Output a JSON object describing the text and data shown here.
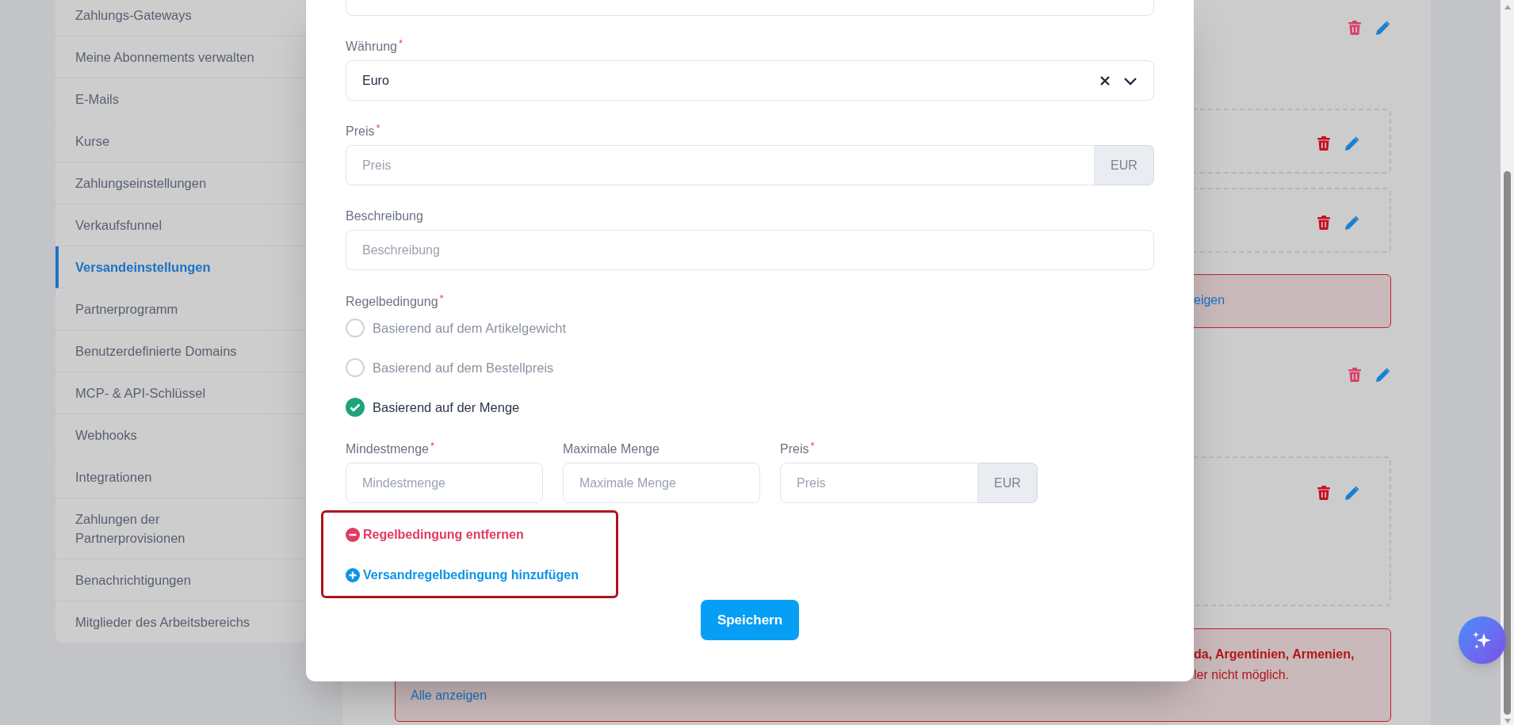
{
  "sidebar": {
    "items": [
      {
        "label": "Zahlungs-Gateways",
        "selected": false
      },
      {
        "label": "Meine Abonnements verwalten",
        "selected": false
      },
      {
        "label": "E-Mails",
        "selected": false
      },
      {
        "label": "Kurse",
        "selected": false
      },
      {
        "label": "Zahlungseinstellungen",
        "selected": false
      },
      {
        "label": "Verkaufsfunnel",
        "selected": false
      },
      {
        "label": "Versandeinstellungen",
        "selected": true
      },
      {
        "label": "Partnerprogramm",
        "selected": false
      },
      {
        "label": "Benutzerdefinierte Domains",
        "selected": false
      },
      {
        "label": "MCP- & API-Schlüssel",
        "selected": false
      },
      {
        "label": "Webhooks",
        "selected": false
      },
      {
        "label": "Integrationen",
        "selected": false
      },
      {
        "label": "Zahlungen der Partnerprovisionen",
        "selected": false
      },
      {
        "label": "Benachrichtigungen",
        "selected": false
      },
      {
        "label": "Mitglieder des Arbeitsbereichs",
        "selected": false
      }
    ]
  },
  "background": {
    "items": [
      {
        "kind": "actions"
      },
      {
        "kind": "card"
      },
      {
        "kind": "card"
      },
      {
        "kind": "alert",
        "link": "eigen"
      },
      {
        "kind": "actions"
      },
      {
        "kind": "large-card"
      },
      {
        "kind": "alert",
        "bold": "da, Argentinien, Armenien,",
        "lines": [
          "ler nicht möglich."
        ],
        "link": "Alle anzeigen"
      }
    ]
  },
  "modal": {
    "currency": {
      "label": "Währung",
      "required_mark": "*",
      "value": "Euro"
    },
    "price": {
      "label": "Preis",
      "required_mark": "*",
      "placeholder": "Preis",
      "suffix": "EUR"
    },
    "description": {
      "label": "Beschreibung",
      "placeholder": "Beschreibung"
    },
    "rule": {
      "label": "Regelbedingung",
      "required_mark": "*",
      "options": [
        {
          "label": "Basierend auf dem Artikelgewicht",
          "selected": false
        },
        {
          "label": "Basierend auf dem Bestellpreis",
          "selected": false
        },
        {
          "label": "Basierend auf der Menge",
          "selected": true
        }
      ]
    },
    "range_fields": [
      {
        "label": "Mindestmenge",
        "required_mark": "*",
        "placeholder": "Mindestmenge"
      },
      {
        "label": "Maximale Menge",
        "placeholder": "Maximale Menge"
      },
      {
        "label": "Preis",
        "required_mark": "*",
        "placeholder": "Preis",
        "suffix": "EUR"
      }
    ],
    "links": [
      {
        "kind": "remove",
        "label": "Regelbedingung entfernen"
      },
      {
        "kind": "add",
        "label": "Versandregelbedingung hinzufügen"
      }
    ],
    "save": "Speichern"
  }
}
